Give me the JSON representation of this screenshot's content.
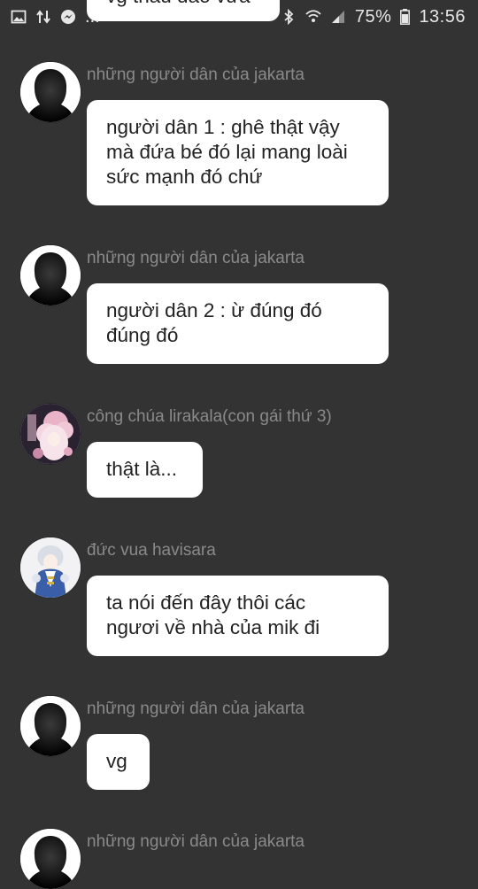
{
  "status_bar": {
    "left_icons": [
      "image-icon",
      "data-transfer-icon",
      "messenger-icon"
    ],
    "more_text": "...",
    "right_icons": [
      "bluetooth-icon",
      "wifi-icon",
      "signal-icon"
    ],
    "battery": "75%",
    "time": "13:56"
  },
  "messages": [
    {
      "sender": "",
      "lines": [
        "vg thấu đáo vừa"
      ],
      "avatar": null
    },
    {
      "sender": "những người dân của jakarta",
      "lines": [
        "người dân 1 :  ghê thật vậy",
        "mà đứa bé đó lại mang loài",
        "sức mạnh đó chứ"
      ],
      "avatar": "silhouette-icon"
    },
    {
      "sender": "những người dân của jakarta",
      "lines": [
        "người dân 2 : ừ đúng đó",
        "đúng đó"
      ],
      "avatar": "silhouette-icon"
    },
    {
      "sender": "công chúa lirakala(con gái thứ 3)",
      "lines": [
        "thật là..."
      ],
      "avatar": "anime-girl-avatar"
    },
    {
      "sender": "đức vua havisara",
      "lines": [
        "ta nói đến đây thôi các",
        "ngươi về nhà của mik đi"
      ],
      "avatar": "anime-king-avatar"
    },
    {
      "sender": "những người dân của jakarta",
      "lines": [
        "vg"
      ],
      "avatar": "silhouette-icon"
    },
    {
      "sender": "những người dân của jakarta",
      "lines": [],
      "avatar": "silhouette-icon"
    }
  ],
  "colors": {
    "background": "#333333",
    "bubble": "#ffffff",
    "sender_text": "#8a8a8a",
    "status_text": "#e6e6e6"
  }
}
